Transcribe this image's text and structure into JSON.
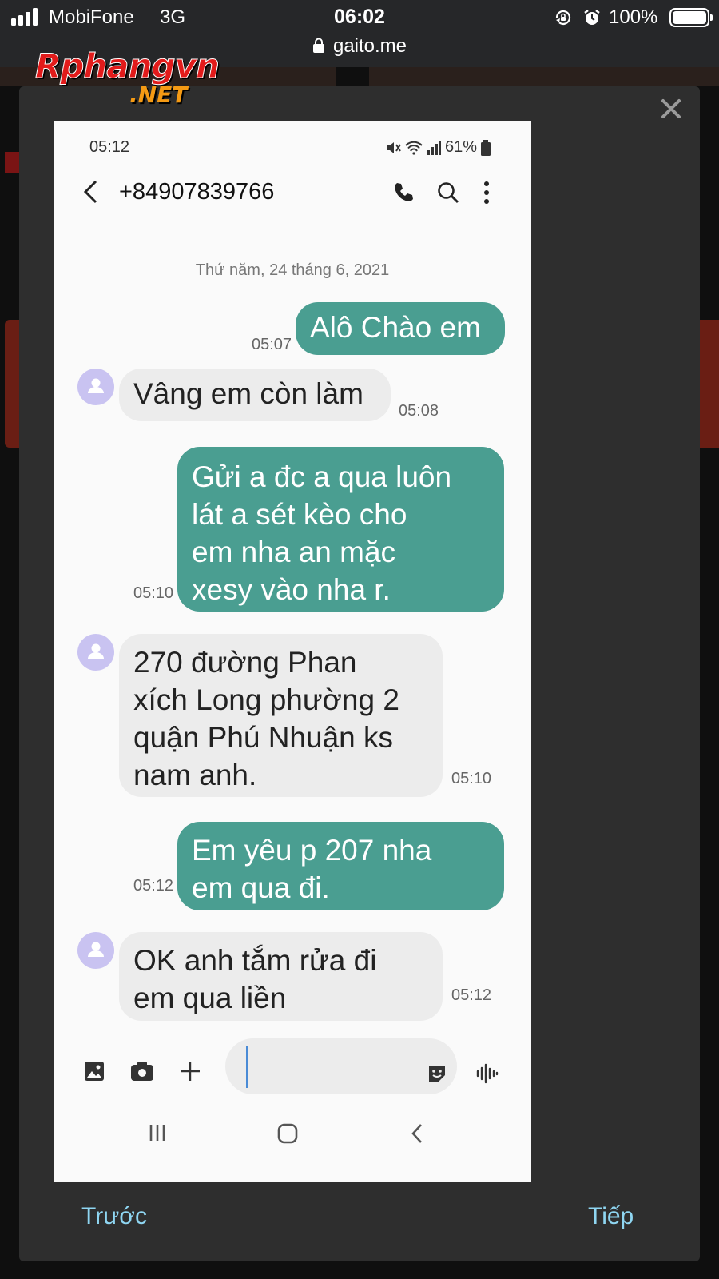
{
  "ios_status": {
    "carrier": "MobiFone",
    "network": "3G",
    "time": "06:02",
    "battery": "100%"
  },
  "browser": {
    "url": "gaito.me"
  },
  "watermark": {
    "main": "Rphangvn",
    "sub": ".NET"
  },
  "screenshot": {
    "status_time": "05:12",
    "status_battery": "61%",
    "contact": "+84907839766",
    "date_separator": "Thứ năm, 24 tháng 6, 2021",
    "messages": [
      {
        "dir": "out",
        "text": "Alô Chào em",
        "time": "05:07"
      },
      {
        "dir": "in",
        "text": "Vâng em còn làm",
        "time": "05:08"
      },
      {
        "dir": "out",
        "text": "Gửi a đc  a qua luôn\nlát  a sét  kèo  cho\nem  nha  an  mặc\nxesy  vào  nha  r.",
        "time": "05:10"
      },
      {
        "dir": "in",
        "text": "270 đường Phan\nxích Long phường 2\nquận Phú Nhuận ks\nnam anh.",
        "time": "05:10"
      },
      {
        "dir": "out",
        "text": "Em yêu  p 207 nha\nem qua đi.",
        "time": "05:12"
      },
      {
        "dir": "in",
        "text": "OK anh tắm rửa đi\nem qua liền",
        "time": "05:12"
      }
    ]
  },
  "modal": {
    "prev_label": "Trước",
    "next_label": "Tiếp"
  },
  "colors": {
    "outgoing_bubble": "#4a9e91",
    "incoming_bubble": "#ececec",
    "modal_bg": "#2e2e2e",
    "nav_link": "#8fd6f2"
  }
}
